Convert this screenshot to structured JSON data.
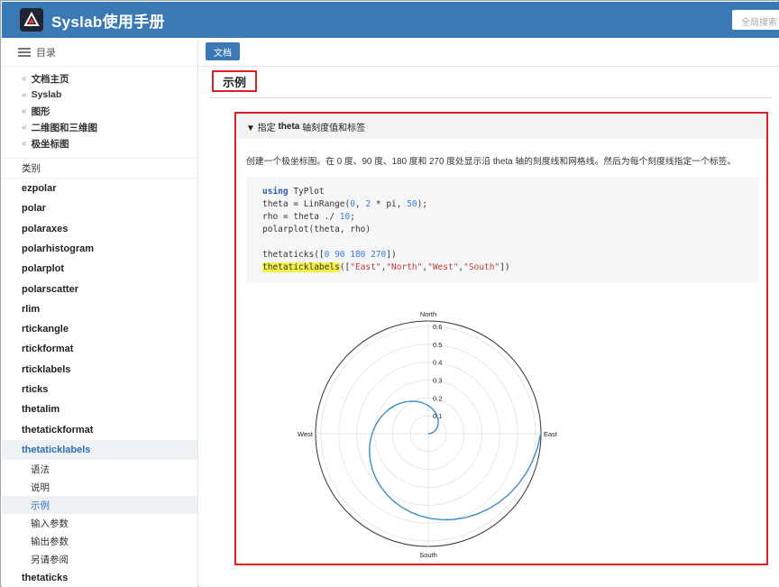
{
  "app": {
    "title": "Syslab使用手册",
    "search_placeholder": "全局搜索"
  },
  "sidebar": {
    "toc_label": "目录",
    "breadcrumbs": [
      "文档主页",
      "Syslab",
      "图形",
      "二维图和三维图",
      "极坐标图"
    ],
    "category_label": "类别",
    "items": [
      "ezpolar",
      "polar",
      "polaraxes",
      "polarhistogram",
      "polarplot",
      "polarscatter",
      "rlim",
      "rtickangle",
      "rtickformat",
      "rticklabels",
      "rticks",
      "thetalim",
      "thetatickformat",
      "thetaticklabels"
    ],
    "active_item": "thetaticklabels",
    "subitems": [
      "语法",
      "说明",
      "示例",
      "输入参数",
      "输出参数",
      "另请参阅"
    ],
    "active_subitem": "示例",
    "last_item": "thetaticks"
  },
  "main": {
    "doc_tab": "文档",
    "section_title": "示例",
    "example": {
      "heading_prefix": "▼ 指定",
      "heading_code": "theta",
      "heading_suffix": "轴刻度值和标签",
      "description": "创建一个极坐标图。在 0 度、90 度、180 度和 270 度处显示沿 theta 轴的刻度线和网格线。然后为每个刻度线指定一个标签。",
      "code": {
        "l1_kw": "using",
        "l1_rest": " TyPlot",
        "l2_a": "theta = LinRange(",
        "l2_n1": "0",
        "l2_b": ", ",
        "l2_n2": "2",
        "l2_c": " * pi, ",
        "l2_n3": "50",
        "l2_d": ");",
        "l3_a": "rho = theta ./ ",
        "l3_n": "10",
        "l3_b": ";",
        "l4": "polarplot(theta, rho)",
        "l6_a": "thetaticks([",
        "l6_n": "0 90 180 270",
        "l6_b": "])",
        "l7_hl": "thetaticklabels",
        "l7_a": "([",
        "l7_s1": "\"East\"",
        "l7_s2": "\"North\"",
        "l7_s3": "\"West\"",
        "l7_s4": "\"South\"",
        "l7_b": "])",
        "comma": ","
      }
    }
  },
  "chart_data": {
    "type": "line",
    "projection": "polar",
    "theta_ticks_deg": [
      0,
      90,
      180,
      270
    ],
    "theta_tick_labels": [
      "East",
      "North",
      "West",
      "South"
    ],
    "r_ticks": [
      0.1,
      0.2,
      0.3,
      0.4,
      0.5,
      0.6
    ],
    "r_tick_labels": [
      "0.1",
      "0.2",
      "0.3",
      "0.4",
      "0.5",
      "0.6"
    ],
    "rlim": [
      0,
      0.63
    ],
    "series": [
      {
        "theta_start": 0,
        "theta_end": 6.283185307,
        "points": 50,
        "rho_equation": "theta / 10",
        "color": "#3a8fc7"
      }
    ]
  }
}
